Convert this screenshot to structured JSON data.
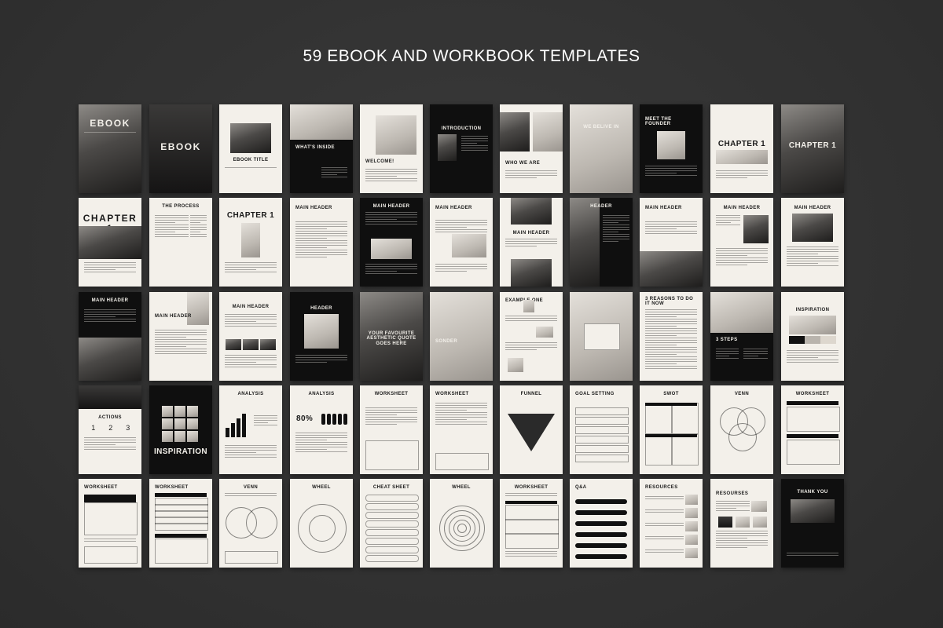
{
  "headline": "59 EBOOK AND WORKBOOK TEMPLATES",
  "pages": [
    {
      "name": "ebook-cover",
      "style": "photo",
      "title": "EBOOK",
      "layout": "cover"
    },
    {
      "name": "ebook-cover-2",
      "style": "photo",
      "title": "EBOOK",
      "layout": "cover2"
    },
    {
      "name": "ebook-title",
      "style": "light",
      "title": "EBOOK TITLE",
      "layout": "titleimg"
    },
    {
      "name": "whats-inside",
      "style": "dark",
      "title": "WHAT'S INSIDE",
      "layout": "inside"
    },
    {
      "name": "welcome",
      "style": "light",
      "title": "WELCOME!",
      "layout": "welcome"
    },
    {
      "name": "introduction",
      "style": "dark",
      "title": "INTRODUCTION",
      "layout": "intro"
    },
    {
      "name": "who-we-are",
      "style": "light",
      "title": "WHO WE ARE",
      "layout": "who"
    },
    {
      "name": "we-believe-in",
      "style": "photo",
      "title": "WE BELIVE IN",
      "layout": "belive"
    },
    {
      "name": "meet-the-founder",
      "style": "dark",
      "title": "MEET THE FOUNDER",
      "layout": "founder"
    },
    {
      "name": "chapter-1-a",
      "style": "light",
      "title": "CHAPTER 1",
      "layout": "chapterimg"
    },
    {
      "name": "chapter-1-b",
      "style": "photo",
      "title": "CHAPTER 1",
      "layout": "chapterphoto"
    },
    {
      "name": "chapter-1-c",
      "style": "light",
      "title": "CHAPTER 1",
      "layout": "chapterbottomimg"
    },
    {
      "name": "the-process",
      "style": "light",
      "title": "THE PROCESS",
      "layout": "process"
    },
    {
      "name": "chapter-1-d",
      "style": "light",
      "title": "CHAPTER 1",
      "layout": "chapterbig"
    },
    {
      "name": "main-header-a",
      "style": "light",
      "title": "MAIN HEADER",
      "layout": "mainquote"
    },
    {
      "name": "main-header-b",
      "style": "dark",
      "title": "MAIN HEADER",
      "layout": "maindark"
    },
    {
      "name": "main-header-c",
      "style": "light",
      "title": "MAIN HEADER",
      "layout": "mainimgright"
    },
    {
      "name": "main-header-d",
      "style": "light",
      "title": "MAIN HEADER",
      "layout": "maintwoimg"
    },
    {
      "name": "header-a",
      "style": "dark",
      "title": "HEADER",
      "layout": "headerdarkimg"
    },
    {
      "name": "main-header-e",
      "style": "light",
      "title": "MAIN HEADER",
      "layout": "mainbottomimg"
    },
    {
      "name": "main-header-f",
      "style": "light",
      "title": "MAIN HEADER",
      "layout": "maincenterimg"
    },
    {
      "name": "main-header-g",
      "style": "light",
      "title": "MAIN HEADER",
      "layout": "maintopimg"
    },
    {
      "name": "main-header-h",
      "style": "dark",
      "title": "MAIN HEADER",
      "layout": "maindarkbottom"
    },
    {
      "name": "main-header-i",
      "style": "light",
      "title": "MAIN HEADER",
      "layout": "mainsideimg"
    },
    {
      "name": "main-header-j",
      "style": "light",
      "title": "MAIN HEADER",
      "layout": "mainthumbs"
    },
    {
      "name": "header-b",
      "style": "dark",
      "title": "HEADER",
      "layout": "headerdark"
    },
    {
      "name": "quote",
      "style": "photo",
      "title": "YOUR FAVOURITE AESTHETIC QUOTE GOES HERE",
      "layout": "quote"
    },
    {
      "name": "sonder",
      "style": "photo",
      "title": "SONDER",
      "layout": "sonder"
    },
    {
      "name": "examples",
      "style": "light",
      "title": "EXAMPLE ONE",
      "layout": "examples"
    },
    {
      "name": "photo-form",
      "style": "photo",
      "title": "",
      "layout": "photoform"
    },
    {
      "name": "3-reasons",
      "style": "light",
      "title": "3 REASONS TO DO IT NOW",
      "layout": "reasons"
    },
    {
      "name": "3-steps",
      "style": "dark",
      "title": "3 STEPS",
      "layout": "steps"
    },
    {
      "name": "inspiration-a",
      "style": "light",
      "title": "INSPIRATION",
      "layout": "inspo"
    },
    {
      "name": "actions",
      "style": "light",
      "title": "ACTIONS",
      "layout": "actions"
    },
    {
      "name": "inspiration-b",
      "style": "dark",
      "title": "INSPIRATION",
      "layout": "inspodark"
    },
    {
      "name": "analysis-a",
      "style": "light",
      "title": "ANALYSIS",
      "layout": "analysisbars"
    },
    {
      "name": "analysis-b",
      "style": "light",
      "title": "ANALYSIS",
      "layout": "analysis80"
    },
    {
      "name": "worksheet-a",
      "style": "light",
      "title": "WORKSHEET",
      "layout": "worksheetlines"
    },
    {
      "name": "worksheet-b",
      "style": "light",
      "title": "WORKSHEET",
      "layout": "worksheetbox"
    },
    {
      "name": "funnel",
      "style": "light",
      "title": "FUNNEL",
      "layout": "funnel"
    },
    {
      "name": "goal-setting",
      "style": "light",
      "title": "GOAL SETTING",
      "layout": "goals"
    },
    {
      "name": "swot",
      "style": "light",
      "title": "SWOT",
      "layout": "swot"
    },
    {
      "name": "venn-a",
      "style": "light",
      "title": "VENN",
      "layout": "venn3"
    },
    {
      "name": "worksheet-c",
      "style": "light",
      "title": "WORKSHEET",
      "layout": "worksheetbars"
    },
    {
      "name": "worksheet-d",
      "style": "light",
      "title": "WORKSHEET",
      "layout": "worksheetbig"
    },
    {
      "name": "worksheet-e",
      "style": "light",
      "title": "WORKSHEET",
      "layout": "worksheettable"
    },
    {
      "name": "venn-b",
      "style": "light",
      "title": "VENN",
      "layout": "venn2"
    },
    {
      "name": "wheel-a",
      "style": "light",
      "title": "WHEEL",
      "layout": "wheel"
    },
    {
      "name": "cheat-sheet",
      "style": "light",
      "title": "CHEAT SHEET",
      "layout": "cheat"
    },
    {
      "name": "wheel-b",
      "style": "light",
      "title": "WHEEL",
      "layout": "radar"
    },
    {
      "name": "worksheet-f",
      "style": "light",
      "title": "WORKSHEET",
      "layout": "worksheetgrid"
    },
    {
      "name": "q-and-a",
      "style": "light",
      "title": "Q&A",
      "layout": "qa"
    },
    {
      "name": "resources-a",
      "style": "light",
      "title": "RESOURCES",
      "layout": "resources"
    },
    {
      "name": "resources-b",
      "style": "light",
      "title": "RESOURSES",
      "layout": "resources2"
    },
    {
      "name": "thank-you",
      "style": "dark",
      "title": "THANK YOU",
      "layout": "thanks"
    }
  ],
  "actions_numbers": [
    "1",
    "2",
    "3"
  ],
  "analysis_percent": "80%"
}
